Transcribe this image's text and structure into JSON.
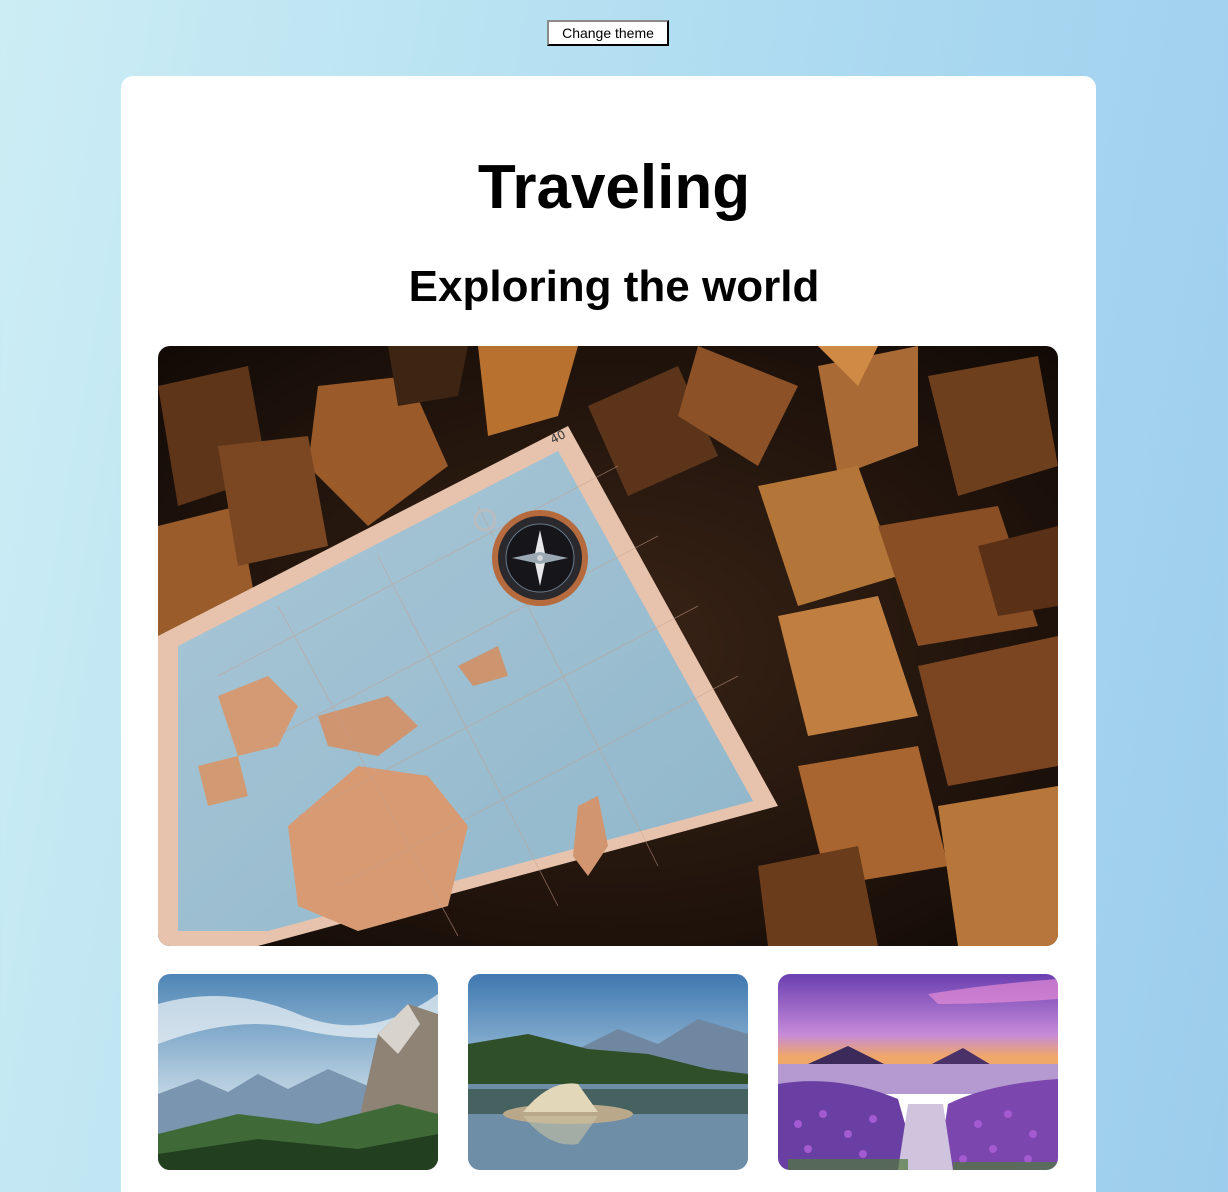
{
  "header": {
    "theme_button_label": "Change theme"
  },
  "main": {
    "title": "Traveling",
    "subtitle": "Exploring the world"
  },
  "images": {
    "hero": "map-compass-leaves-photo",
    "thumbnails": [
      "mountain-valley-photo",
      "lake-tent-photo",
      "lavender-lake-sunset-photo"
    ]
  },
  "colors": {
    "background_gradient_start": "#cdedf4",
    "background_gradient_end": "#9ccdec",
    "card_background": "#ffffff",
    "text": "#000000"
  }
}
